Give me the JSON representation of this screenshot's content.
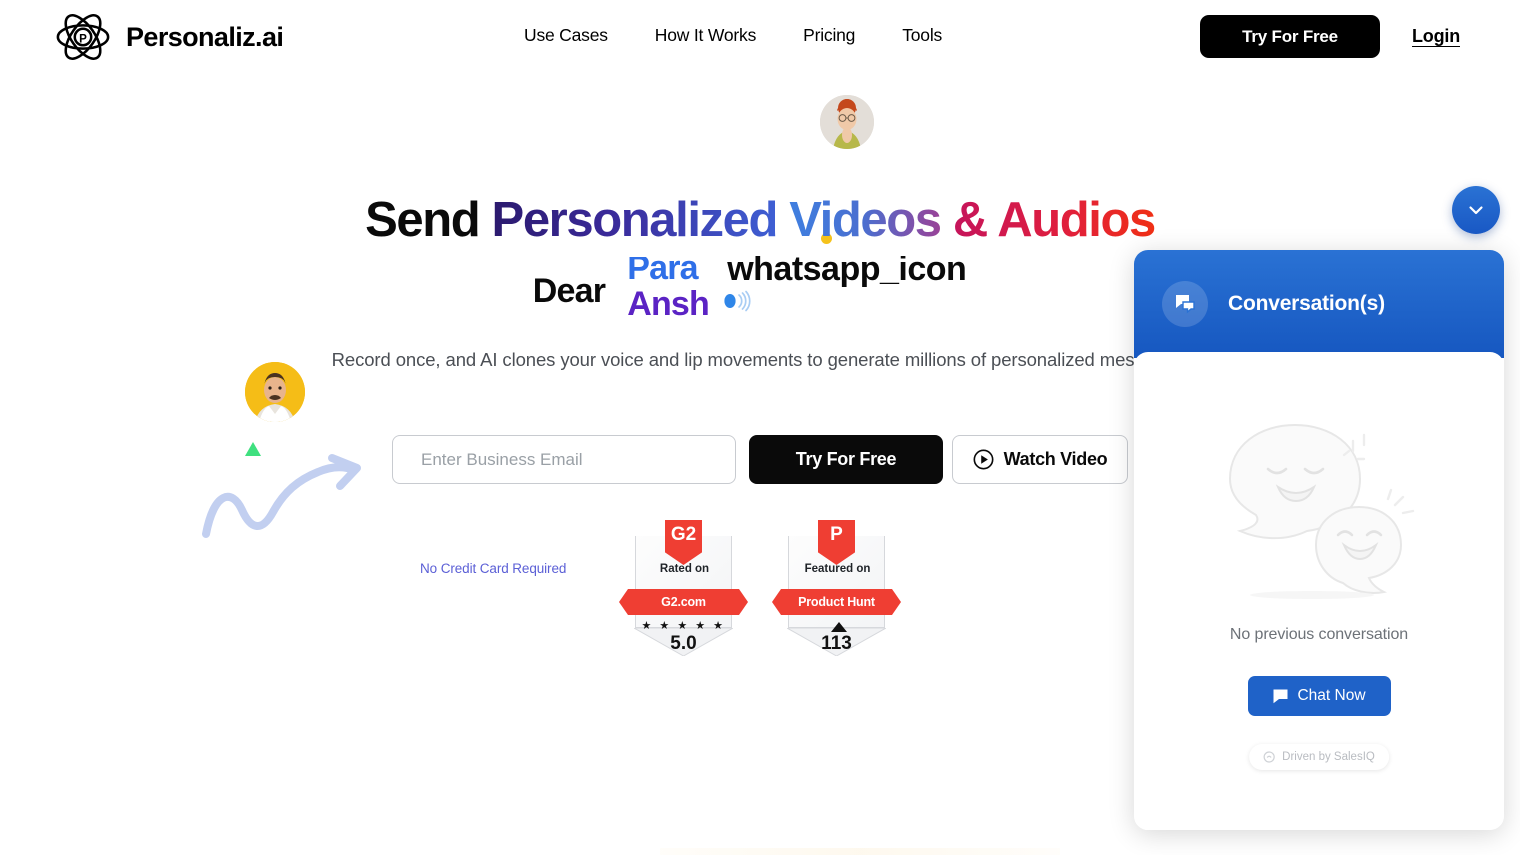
{
  "brand": {
    "name": "Personaliz.ai",
    "logo_icon": "atom-icon"
  },
  "nav": {
    "items": [
      {
        "label": "Use Cases"
      },
      {
        "label": "How It Works"
      },
      {
        "label": "Pricing"
      },
      {
        "label": "Tools"
      }
    ],
    "try_free_label": "Try For Free",
    "login_label": "Login"
  },
  "hero": {
    "headline": {
      "word1": "Send ",
      "word2": "Personalized ",
      "word3": "Videos ",
      "word4": "& Audios"
    },
    "greeting": "Dear",
    "rotating_names": [
      "Para",
      "Ansh"
    ],
    "channel_text": "whatsapp_icon",
    "channel_icon": "whatsapp-signal-icon",
    "subtitle": "Record once, and AI clones your voice and lip movements to generate millions of personalized messages.",
    "email_placeholder": "Enter Business Email",
    "email_value": "",
    "try_free_label": "Try For Free",
    "watch_video_label": "Watch Video",
    "watch_video_icon": "play-circle-icon",
    "no_credit_card": "No Credit Card Required",
    "avatar_top_alt": "woman-avatar",
    "avatar_left_alt": "man-avatar"
  },
  "badges": [
    {
      "emblem": "G2",
      "prefix": "Rated on",
      "flag": "G2.com",
      "stars": "★ ★ ★ ★ ★",
      "score": "5.0",
      "has_triangle": false,
      "color": "#ef3e33"
    },
    {
      "emblem": "P",
      "prefix": "Featured on",
      "flag": "Product Hunt",
      "stars": "",
      "score": "113",
      "has_triangle": true,
      "color": "#ef3e33"
    }
  ],
  "chat": {
    "minimize_icon": "chevron-down-icon",
    "header_icon": "chat-bubbles-icon",
    "header_title": "Conversation(s)",
    "empty_art_icon": "two-smiling-bubbles-icon",
    "empty_text": "No previous conversation",
    "chat_now_label": "Chat Now",
    "chat_now_icon": "chat-icon",
    "footer_text": "Driven by SalesIQ",
    "footer_icon": "salesiq-icon",
    "accent_color": "#1f62c8"
  }
}
